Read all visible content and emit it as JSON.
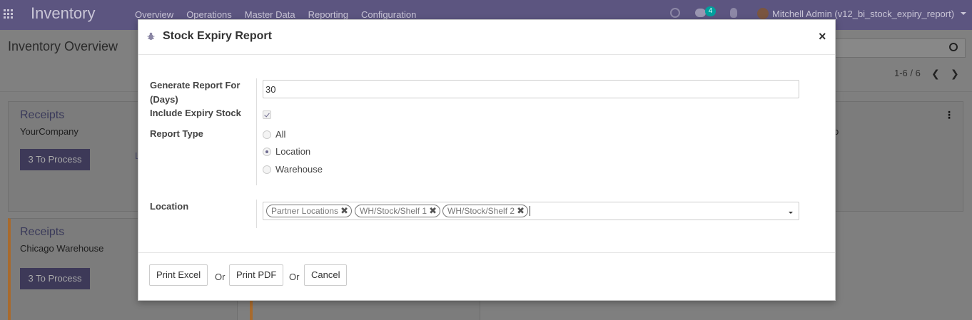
{
  "navbar": {
    "brand": "Inventory",
    "menu": [
      "Overview",
      "Operations",
      "Master Data",
      "Reporting",
      "Configuration"
    ],
    "chat_count": "4",
    "user": "Mitchell Admin (v12_bi_stock_expiry_report)"
  },
  "page": {
    "title": "Inventory Overview",
    "pager": "1-6 / 6",
    "cards": [
      {
        "title": "Receipts",
        "subtitle": "YourCompany",
        "button": "3 To Process",
        "fragment": "L"
      },
      {
        "title": "Receipts",
        "subtitle": "Chicago Warehouse",
        "button": "3 To Process",
        "fragment": "L"
      }
    ],
    "card3_fragment": "o"
  },
  "modal": {
    "title": "Stock Expiry Report",
    "close": "×",
    "fields": {
      "days_label": "Generate Report For (Days)",
      "days_value": "30",
      "expiry_label": "Include Expiry Stock",
      "expiry_checked": true,
      "type_label": "Report Type",
      "type_options": [
        "All",
        "Location",
        "Warehouse"
      ],
      "type_selected": "Location",
      "location_label": "Location",
      "location_tags": [
        "Partner Locations",
        "WH/Stock/Shelf 1",
        "WH/Stock/Shelf 2"
      ]
    },
    "footer": {
      "print_excel": "Print Excel",
      "or": "Or",
      "print_pdf": "Print PDF",
      "cancel": "Cancel"
    }
  },
  "colors": {
    "navbar": "#5c5580",
    "accent": "#6e6a8f",
    "backdrop": "#7f7f7f"
  }
}
